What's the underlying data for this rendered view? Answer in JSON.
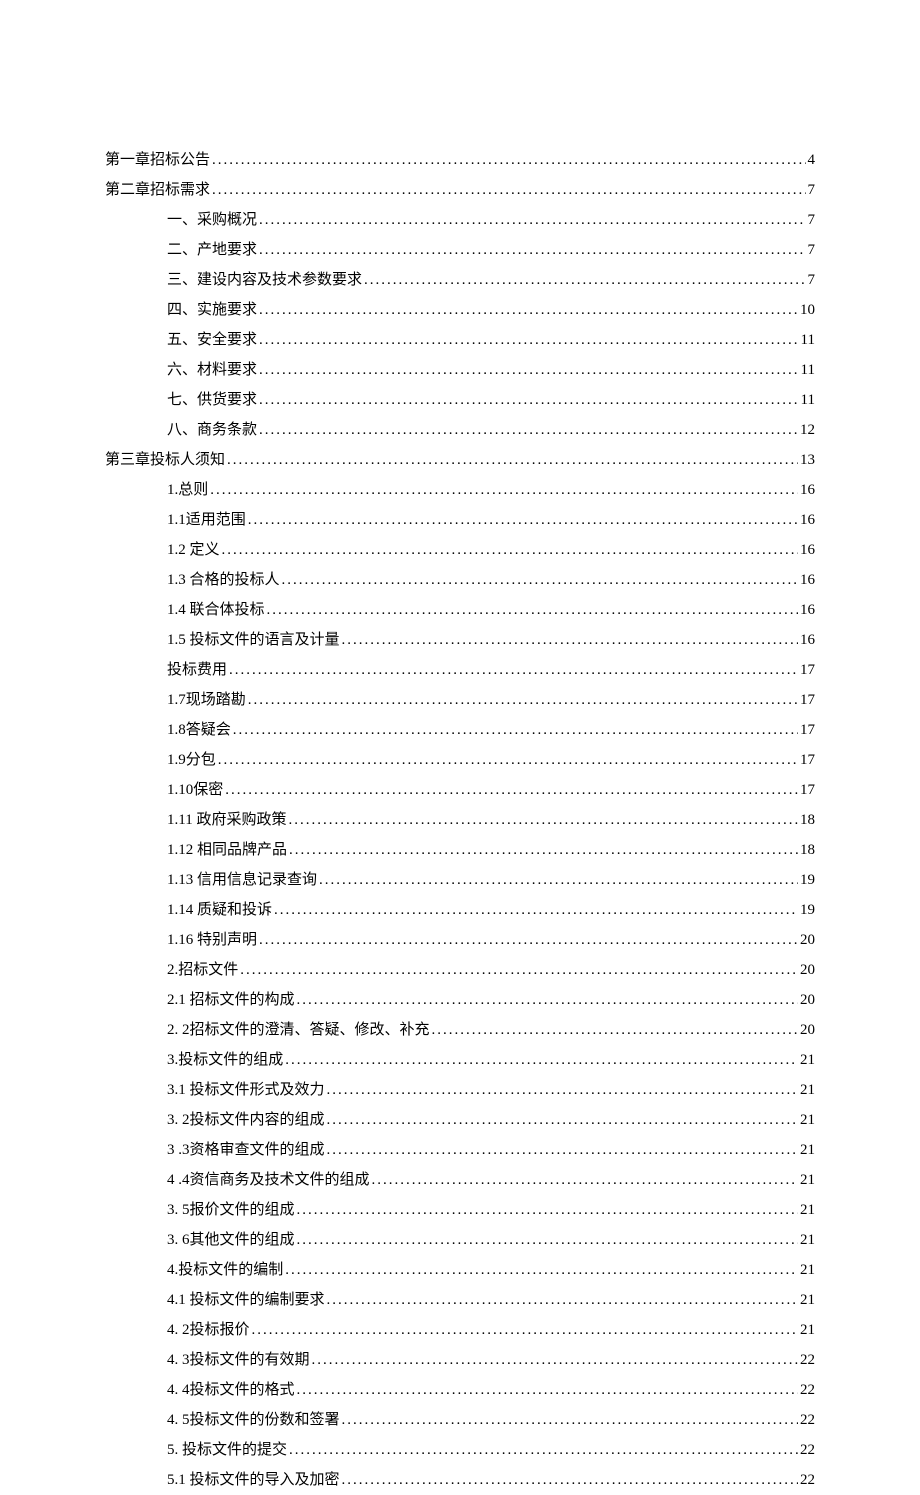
{
  "toc": [
    {
      "level": 0,
      "label": "第一章招标公告",
      "page": "4"
    },
    {
      "level": 0,
      "label": "第二章招标需求",
      "page": "7"
    },
    {
      "level": 1,
      "label": "一、采购概况 ",
      "page": "7"
    },
    {
      "level": 1,
      "label": "二、产地要求 ",
      "page": "7"
    },
    {
      "level": 1,
      "label": "三、建设内容及技术参数要求 ",
      "page": "7"
    },
    {
      "level": 1,
      "label": "四、实施要求 ",
      "page": "10"
    },
    {
      "level": 1,
      "label": "五、安全要求 ",
      "page": "11"
    },
    {
      "level": 1,
      "label": "六、材料要求 ",
      "page": "11"
    },
    {
      "level": 1,
      "label": "七、供货要求 ",
      "page": "11"
    },
    {
      "level": 1,
      "label": "八、商务条款 ",
      "page": "12"
    },
    {
      "level": 0,
      "label": "第三章投标人须知",
      "page": "13"
    },
    {
      "level": 1,
      "label": "1.总则 ",
      "page": "16"
    },
    {
      "level": 1,
      "label": "1.1适用范围 ",
      "page": "16"
    },
    {
      "level": 1,
      "label": "1.2  定义",
      "page": "16"
    },
    {
      "level": 1,
      "label": "1.3  合格的投标人",
      "page": "16"
    },
    {
      "level": 1,
      "label": "1.4  联合体投标",
      "page": "16"
    },
    {
      "level": 1,
      "label": "1.5  投标文件的语言及计量",
      "page": "16"
    },
    {
      "level": 1,
      "label": "投标费用 ",
      "page": "17"
    },
    {
      "level": 1,
      "label": "1.7现场踏勘 ",
      "page": "17"
    },
    {
      "level": 1,
      "label": "1.8答疑会 ",
      "page": "17"
    },
    {
      "level": 1,
      "label": "1.9分包 ",
      "page": "17"
    },
    {
      "level": 1,
      "label": "1.10保密 ",
      "page": "17"
    },
    {
      "level": 1,
      "label": "1.11  政府采购政策",
      "page": "18"
    },
    {
      "level": 1,
      "label": "1.12  相同品牌产品",
      "page": "18"
    },
    {
      "level": 1,
      "label": "1.13  信用信息记录查询",
      "page": "19"
    },
    {
      "level": 1,
      "label": "1.14  质疑和投诉",
      "page": "19"
    },
    {
      "level": 1,
      "label": "1.16  特别声明",
      "page": "20"
    },
    {
      "level": 1,
      "label": "2.招标文件 ",
      "page": "20"
    },
    {
      "level": 1,
      "label": "2.1  招标文件的构成",
      "page": "20"
    },
    {
      "level": 1,
      "label": "2.  2招标文件的澄清、答疑、修改、补充",
      "page": "20"
    },
    {
      "level": 1,
      "label": "3.投标文件的组成 ",
      "page": "21"
    },
    {
      "level": 1,
      "label": "3.1  投标文件形式及效力",
      "page": "21"
    },
    {
      "level": 1,
      "label": "3.  2投标文件内容的组成",
      "page": "21"
    },
    {
      "level": 1,
      "label": "3  .3资格审查文件的组成 ",
      "page": "21"
    },
    {
      "level": 1,
      "label": "4  .4资信商务及技术文件的组成 ",
      "page": "21"
    },
    {
      "level": 1,
      "label": "3.  5报价文件的组成",
      "page": "21"
    },
    {
      "level": 1,
      "label": "3.  6其他文件的组成",
      "page": "21"
    },
    {
      "level": 1,
      "label": "4.投标文件的编制 ",
      "page": "21"
    },
    {
      "level": 1,
      "label": "4.1  投标文件的编制要求",
      "page": "21"
    },
    {
      "level": 1,
      "label": "4.  2投标报价",
      "page": "21"
    },
    {
      "level": 1,
      "label": "4.  3投标文件的有效期",
      "page": "22"
    },
    {
      "level": 1,
      "label": "4.  4投标文件的格式",
      "page": "22"
    },
    {
      "level": 1,
      "label": "4.  5投标文件的份数和签署",
      "page": "22"
    },
    {
      "level": 1,
      "label": "5.  投标文件的提交 ",
      "page": "22"
    },
    {
      "level": 1,
      "label": "5.1  投标文件的导入及加密",
      "page": "22"
    }
  ]
}
